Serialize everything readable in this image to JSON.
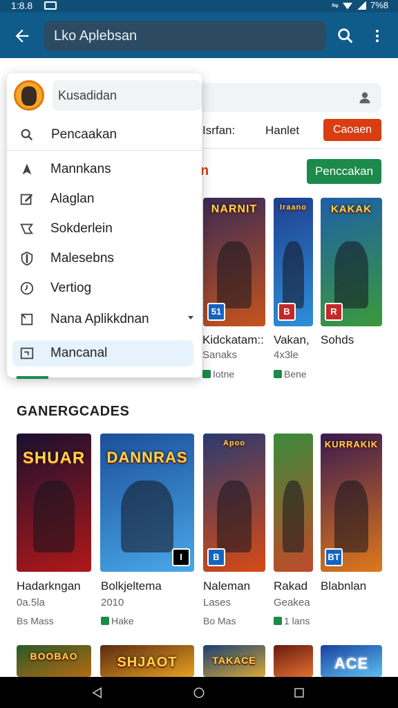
{
  "status_bar": {
    "time": "1:8.8",
    "battery": "7%8"
  },
  "app_bar": {
    "title": "Lko Aplebsan"
  },
  "drawer": {
    "user_field": "Kusadidan",
    "search_label": "Pencaakan",
    "items": [
      {
        "label": "Mannkans",
        "icon": "navigation-arrow-icon"
      },
      {
        "label": "Alaglan",
        "icon": "edit-box-icon"
      },
      {
        "label": "Sokderlein",
        "icon": "tag-icon"
      },
      {
        "label": "Malesebns",
        "icon": "shield-icon"
      },
      {
        "label": "Vertiog",
        "icon": "clock-icon"
      },
      {
        "label": "Nana  Aplikkdnan",
        "icon": "bookmark-icon"
      },
      {
        "label": "Mancanal",
        "icon": "window-icon"
      }
    ]
  },
  "tabs": {
    "tab1": "Isrfan:",
    "tab2": "Hanlet",
    "tab3": "Caoaen"
  },
  "section1": {
    "title_fragment": "n",
    "button": "Penccakan"
  },
  "row1": [
    {
      "art": "NARNIT",
      "badge": "51",
      "badge_color": "#1565c0",
      "label": "Kidckatam::",
      "sub": "Sanaks",
      "meta": "Iotne",
      "colors": [
        "#3a2a55",
        "#c6541d"
      ]
    },
    {
      "art": "Iraano",
      "badge": "B",
      "badge_color": "#c62828",
      "label": "Vakan,",
      "sub": "4x3le",
      "meta": "Bene",
      "colors": [
        "#1f3f8f",
        "#2f8fd8"
      ]
    },
    {
      "art": "KAKAK",
      "badge": "R",
      "badge_color": "#c62828",
      "label": "Sohds",
      "sub": "",
      "meta": "",
      "colors": [
        "#1e5fa8",
        "#3a9a3a"
      ]
    }
  ],
  "section2": {
    "title": "GANERGCADES"
  },
  "row2": [
    {
      "art": "SHUAR",
      "badge": "",
      "badge_color": "#000000",
      "label": "Hadarkngan",
      "sub": "0a.5la",
      "meta": "Bs Mass",
      "colors": [
        "#1a1030",
        "#b01818"
      ]
    },
    {
      "art": "DANNRAS",
      "badge": "I",
      "badge_color": "#000000",
      "label": "Bolkjeltema",
      "sub": "2010",
      "meta": "Hake",
      "colors": [
        "#1c4f9a",
        "#49a8e8"
      ]
    },
    {
      "art": "Apoo",
      "badge": "B",
      "badge_color": "#1565c0",
      "label": "Naleman",
      "sub": "Lases",
      "meta": "Bo Mas",
      "colors": [
        "#2a3a70",
        "#d84a14"
      ]
    },
    {
      "art": "",
      "badge": "",
      "badge_color": "#000000",
      "label": "Rakad",
      "sub": "Geakea",
      "meta": "1 lans",
      "colors": [
        "#3a8a3a",
        "#c04a2a"
      ]
    },
    {
      "art": "KURRAKIK",
      "badge": "BT",
      "badge_color": "#1565c0",
      "label": "Blabnlan",
      "sub": "",
      "meta": "",
      "colors": [
        "#3a1a50",
        "#e0781a"
      ]
    }
  ],
  "row3": [
    {
      "art": "BOOBAO",
      "colors": [
        "#2a5a2a",
        "#b56a10"
      ]
    },
    {
      "art": "SHJAOT",
      "colors": [
        "#5a2a10",
        "#e8a020"
      ]
    },
    {
      "art": "TAKACE",
      "colors": [
        "#1a3f70",
        "#d8a83a"
      ]
    },
    {
      "art": "",
      "colors": [
        "#6a1a10",
        "#e07030"
      ]
    },
    {
      "art": "ACE",
      "colors": [
        "#1a40a0",
        "#5ac0f0"
      ]
    }
  ]
}
